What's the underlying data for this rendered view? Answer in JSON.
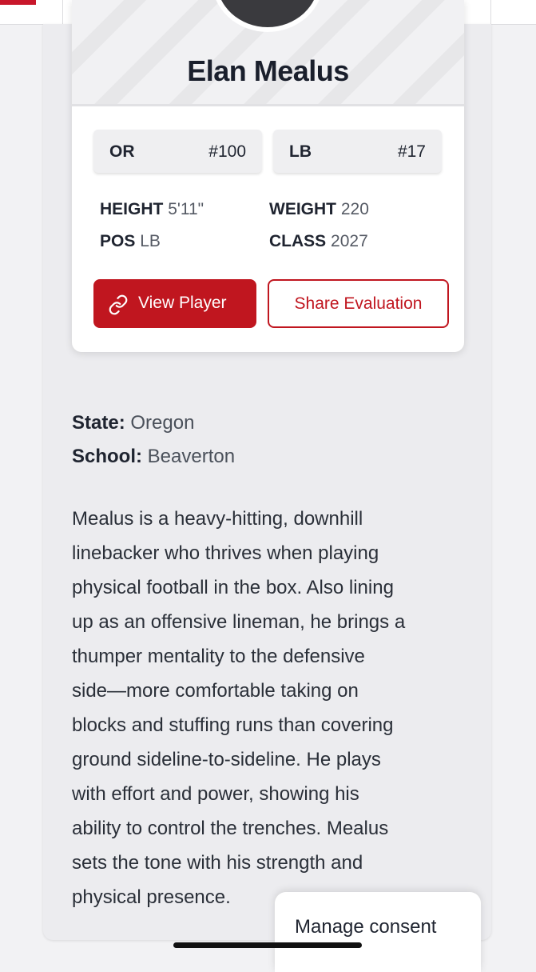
{
  "player": {
    "name": "Elan Mealus",
    "state_chip": {
      "label": "OR",
      "rank": "#100"
    },
    "position_chip": {
      "label": "LB",
      "rank": "#17"
    },
    "stats": {
      "height_label": "HEIGHT",
      "height_value": "5'11\"",
      "weight_label": "WEIGHT",
      "weight_value": "220",
      "pos_label": "POS",
      "pos_value": "LB",
      "class_label": "CLASS",
      "class_value": "2027"
    },
    "buttons": {
      "view_player": "View Player",
      "share_evaluation": "Share Evaluation"
    }
  },
  "details": {
    "state_label": "State:",
    "state_value": "Oregon",
    "school_label": "School:",
    "school_value": "Beaverton"
  },
  "bio_lines": [
    "Mealus is a heavy-hitting, downhill",
    "linebacker who thrives when playing",
    "physical football in the box. Also lining",
    "up as an offensive lineman, he brings a",
    "thumper mentality to the defensive",
    "side—more comfortable taking on",
    "blocks and stuffing runs than covering",
    "ground sideline-to-sideline. He plays",
    "with effort and power, showing his",
    "ability to control the trenches. Mealus",
    "sets the tone with his strength and",
    "physical presence."
  ],
  "consent": {
    "label": "Manage consent"
  },
  "icons": {
    "view_player": "link-icon"
  },
  "colors": {
    "accent": "#c0161f",
    "text": "#1f2430"
  }
}
